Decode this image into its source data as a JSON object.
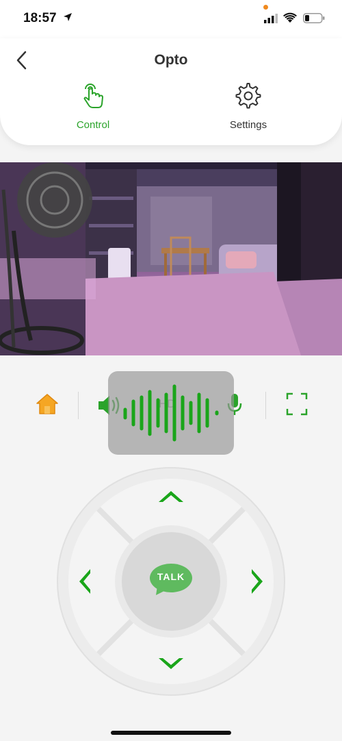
{
  "status_bar": {
    "time": "18:57",
    "icons": [
      "location-arrow-icon",
      "cellular-signal-icon",
      "wifi-icon",
      "battery-icon"
    ]
  },
  "header": {
    "back_icon": "chevron-left-icon",
    "title": "Opto",
    "tabs": [
      {
        "label": "Control",
        "icon": "hand-tap-icon",
        "active": true
      },
      {
        "label": "Settings",
        "icon": "gear-icon",
        "active": false
      }
    ]
  },
  "camera": {
    "description_icon": "camera-live-view"
  },
  "toolbar": {
    "home_icon": "home-icon",
    "speaker_icon": "speaker-icon",
    "quality_label": "HD",
    "mic_icon": "microphone-icon",
    "fullscreen_icon": "fullscreen-icon"
  },
  "voice_overlay": {
    "icon": "waveform-icon"
  },
  "dpad": {
    "up_icon": "chevron-up-icon",
    "down_icon": "chevron-down-icon",
    "left_icon": "chevron-left-icon",
    "right_icon": "chevron-right-icon",
    "talk_label": "TALK"
  },
  "colors": {
    "accent": "#2aa32a",
    "home_icon": "#f5a623",
    "header_bg": "#ffffff",
    "page_bg": "#f4f4f4"
  }
}
